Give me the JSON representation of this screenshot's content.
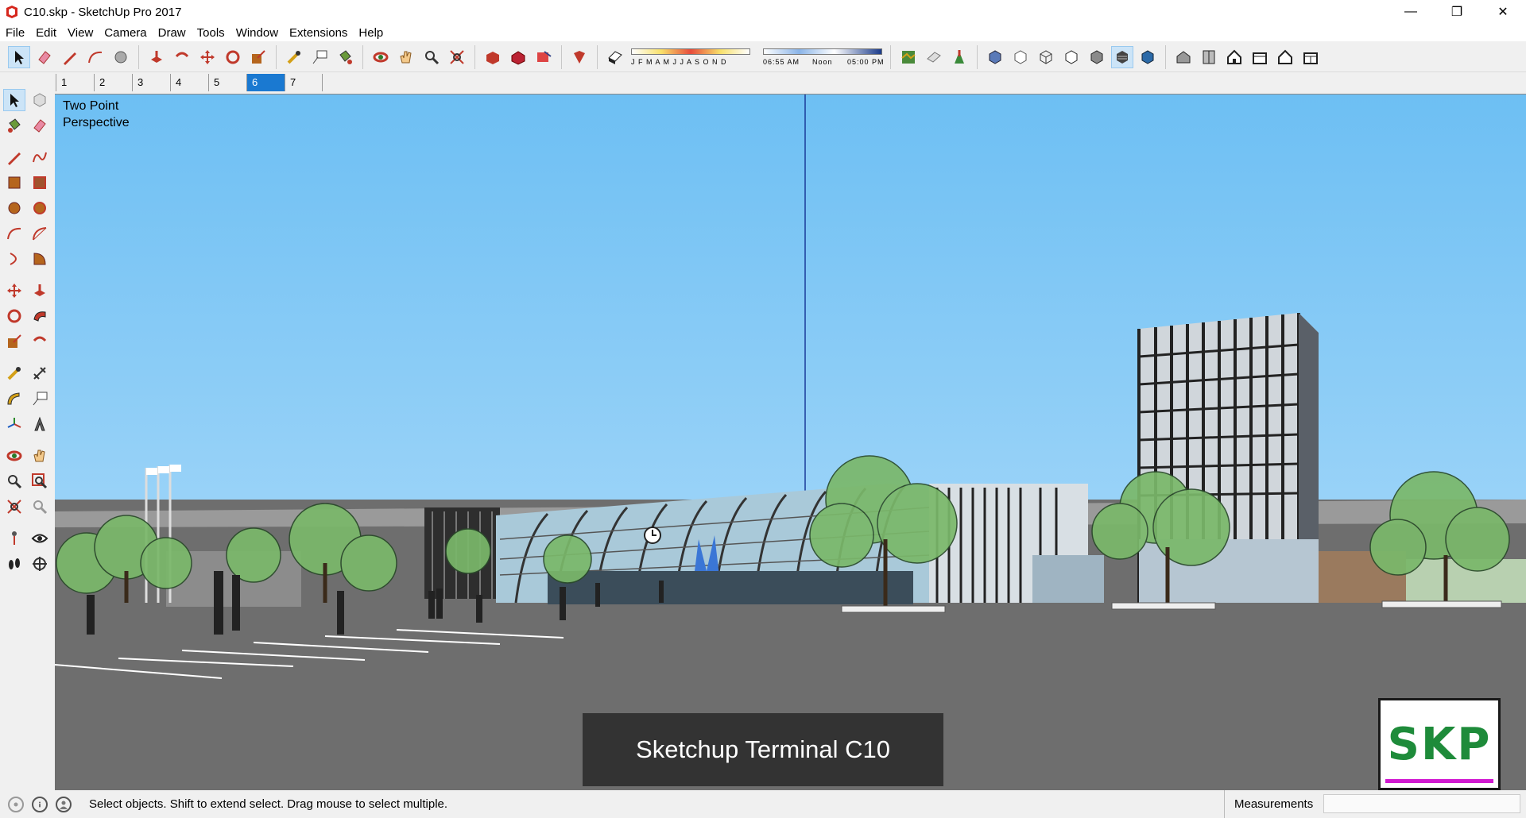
{
  "window": {
    "title": "C10.skp - SketchUp Pro 2017",
    "minimize_glyph": "—",
    "restore_glyph": "❐",
    "close_glyph": "✕"
  },
  "menu": [
    "File",
    "Edit",
    "View",
    "Camera",
    "Draw",
    "Tools",
    "Window",
    "Extensions",
    "Help"
  ],
  "shadows": {
    "months_label": "J F M A M J J A S O N D",
    "time_start": "06:55 AM",
    "time_mid": "Noon",
    "time_end": "05:00 PM"
  },
  "scenes": {
    "tabs": [
      "1",
      "2",
      "3",
      "4",
      "5",
      "6",
      "7"
    ],
    "active_index": 5
  },
  "viewport": {
    "camera_label_line1": "Two Point",
    "camera_label_line2": "Perspective",
    "caption": "Sketchup Terminal C10",
    "logo_text": "SKP"
  },
  "statusbar": {
    "hint": "Select objects. Shift to extend select. Drag mouse to select multiple.",
    "measurements_label": "Measurements",
    "measurements_value": ""
  },
  "colors": {
    "sky_top": "#6dbff3",
    "ground": "#6e6e6e",
    "active_tab": "#1a79d1",
    "logo_green": "#1e8b3a"
  }
}
